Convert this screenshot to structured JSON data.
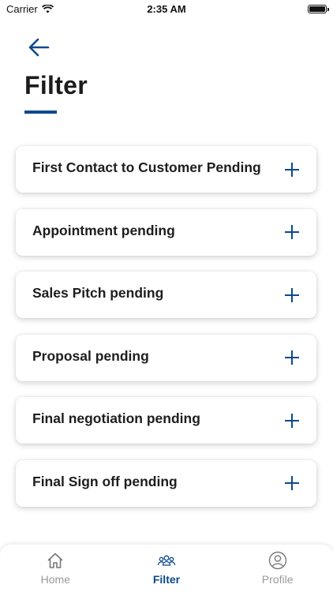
{
  "status_bar": {
    "carrier": "Carrier",
    "time": "2:35 AM"
  },
  "header": {
    "title": "Filter"
  },
  "filters": [
    {
      "label": "First Contact to Customer Pending"
    },
    {
      "label": "Appointment pending"
    },
    {
      "label": "Sales Pitch pending"
    },
    {
      "label": "Proposal pending"
    },
    {
      "label": "Final negotiation pending"
    },
    {
      "label": "Final Sign off pending"
    }
  ],
  "tab_bar": {
    "tabs": [
      {
        "label": "Home",
        "icon": "home-icon",
        "active": false
      },
      {
        "label": "Filter",
        "icon": "group-icon",
        "active": true
      },
      {
        "label": "Profile",
        "icon": "profile-icon",
        "active": false
      }
    ]
  },
  "colors": {
    "accent": "#0b4a8b",
    "inactive": "#9a9a9a"
  }
}
